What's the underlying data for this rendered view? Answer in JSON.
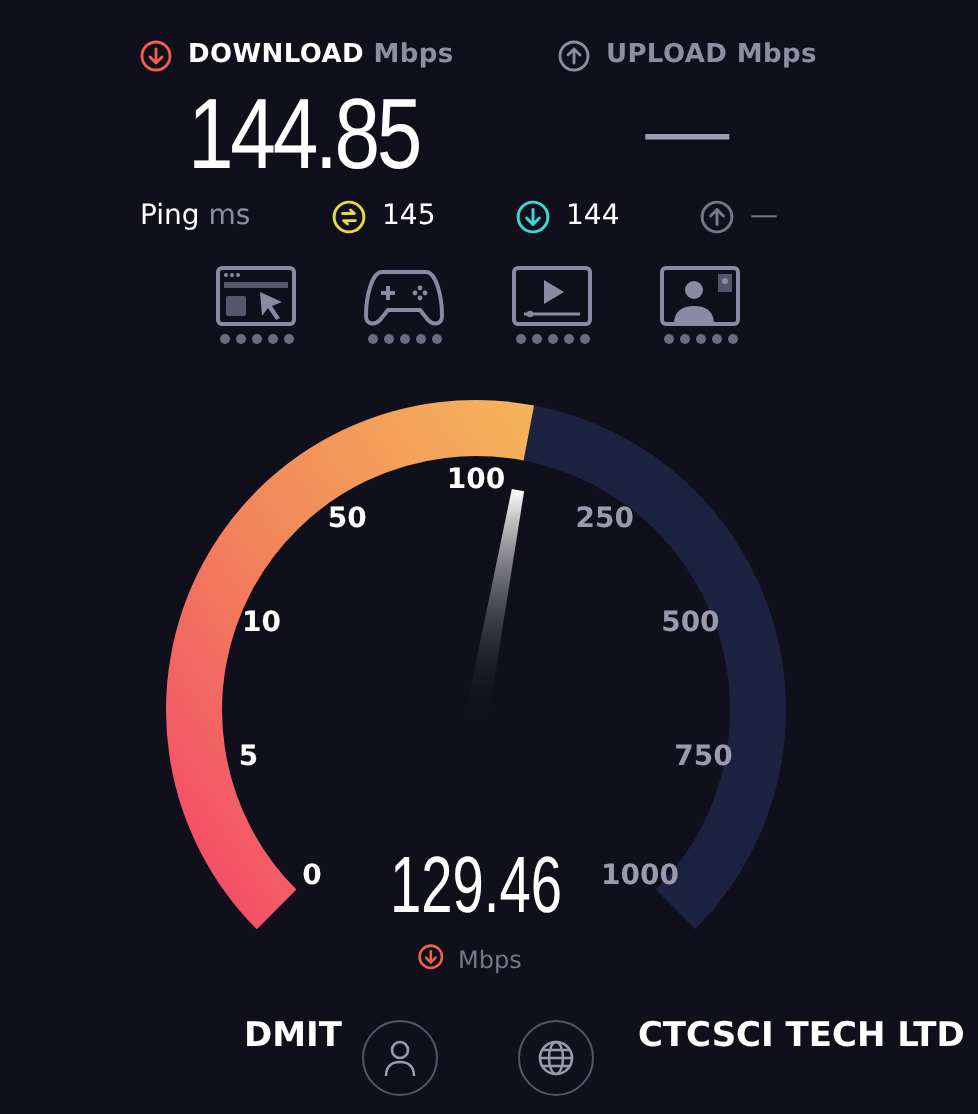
{
  "download": {
    "label": "DOWNLOAD",
    "unit": "Mbps",
    "value": "144.85"
  },
  "upload": {
    "label": "UPLOAD",
    "unit": "Mbps",
    "value": "—"
  },
  "ping": {
    "label": "Ping",
    "unit": "ms",
    "items": [
      {
        "kind": "idle",
        "value": "145",
        "color": "#e8d64c"
      },
      {
        "kind": "download",
        "value": "144",
        "color": "#3fd6d0"
      },
      {
        "kind": "upload",
        "value": "—",
        "color": "#77778a"
      }
    ]
  },
  "tests": [
    {
      "kind": "web"
    },
    {
      "kind": "gaming"
    },
    {
      "kind": "video"
    },
    {
      "kind": "call"
    }
  ],
  "gauge": {
    "ticks": [
      {
        "label": "0",
        "active": true
      },
      {
        "label": "5",
        "active": true
      },
      {
        "label": "10",
        "active": true
      },
      {
        "label": "50",
        "active": true
      },
      {
        "label": "100",
        "active": true
      },
      {
        "label": "250",
        "active": false
      },
      {
        "label": "500",
        "active": false
      },
      {
        "label": "750",
        "active": false
      },
      {
        "label": "1000",
        "active": false
      }
    ],
    "reading": "129.46",
    "unit": "Mbps"
  },
  "provider": {
    "name": "DMIT"
  },
  "server": {
    "name": "CTCSCI TECH LTD"
  }
}
